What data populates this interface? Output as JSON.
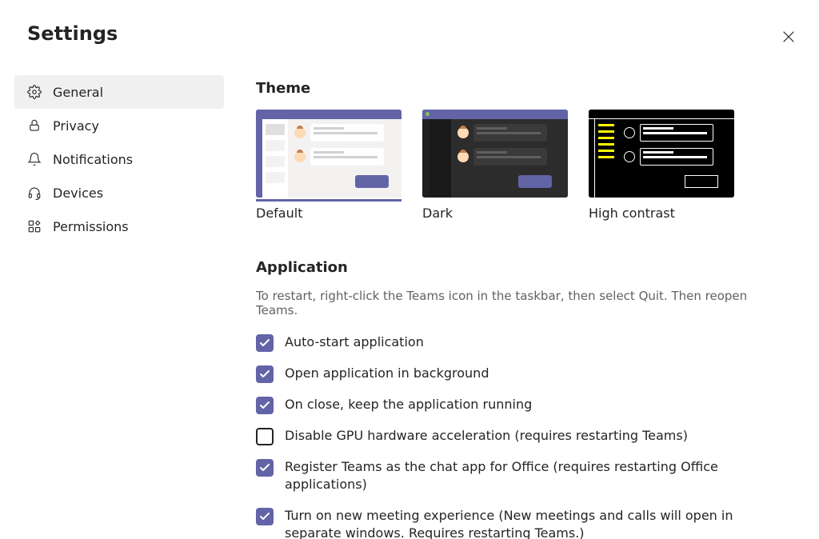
{
  "title": "Settings",
  "sidebar": {
    "items": [
      {
        "label": "General",
        "selected": true
      },
      {
        "label": "Privacy",
        "selected": false
      },
      {
        "label": "Notifications",
        "selected": false
      },
      {
        "label": "Devices",
        "selected": false
      },
      {
        "label": "Permissions",
        "selected": false
      }
    ]
  },
  "theme": {
    "heading": "Theme",
    "options": [
      {
        "label": "Default",
        "selected": true
      },
      {
        "label": "Dark",
        "selected": false
      },
      {
        "label": "High contrast",
        "selected": false
      }
    ]
  },
  "application": {
    "heading": "Application",
    "description": "To restart, right-click the Teams icon in the taskbar, then select Quit. Then reopen Teams.",
    "options": [
      {
        "label": "Auto-start application",
        "checked": true
      },
      {
        "label": "Open application in background",
        "checked": true
      },
      {
        "label": "On close, keep the application running",
        "checked": true
      },
      {
        "label": "Disable GPU hardware acceleration (requires restarting Teams)",
        "checked": false
      },
      {
        "label": "Register Teams as the chat app for Office (requires restarting Office applications)",
        "checked": true
      },
      {
        "label": "Turn on new meeting experience (New meetings and calls will open in separate windows. Requires restarting Teams.)",
        "checked": true
      }
    ]
  },
  "colors": {
    "accent": "#6264a7",
    "text": "#252423",
    "muted": "#616161"
  }
}
